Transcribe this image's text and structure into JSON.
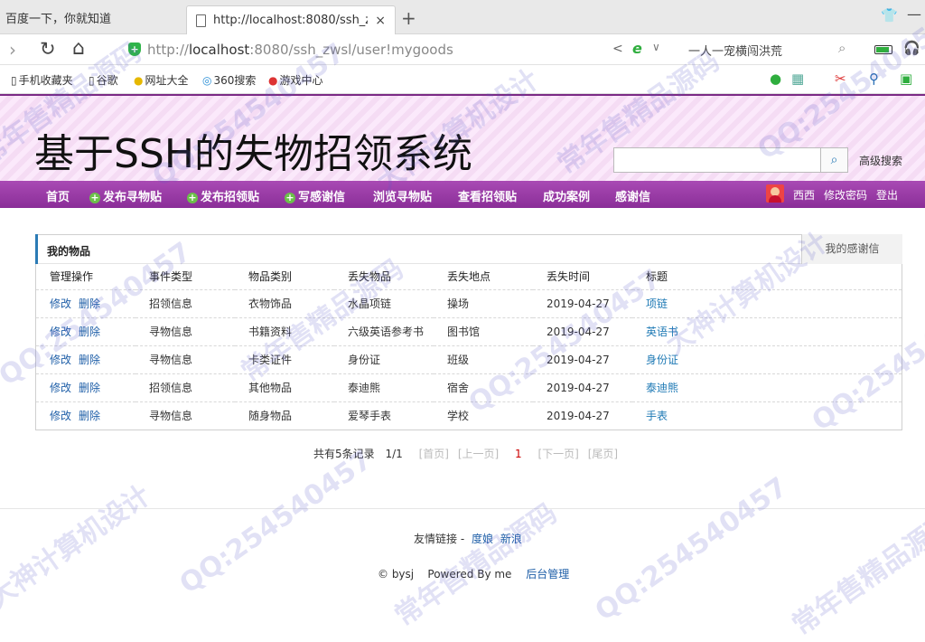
{
  "browser": {
    "tab_inactive": "百度一下，你就知道",
    "tab_active": "http://localhost:8080/ssh_zwsl",
    "tab_close": "×",
    "tab_new": "+",
    "url_prefix": "http://",
    "url_host": "localhost",
    "url_rest": ":8080/ssh_zwsl/user!mygoods",
    "search_suggest": "一人一宠横闯洪荒",
    "bookmarks": [
      "手机收藏夹",
      "谷歌",
      "网址大全",
      "360搜索",
      "游戏中心"
    ]
  },
  "site": {
    "title": "基于SSH的失物招领系统",
    "search_placeholder": "",
    "advanced_search": "高级搜索"
  },
  "nav": {
    "items": [
      "首页",
      "发布寻物贴",
      "发布招领贴",
      "写感谢信",
      "浏览寻物贴",
      "查看招领贴",
      "成功案例",
      "感谢信"
    ],
    "user": "西西",
    "change_password": "修改密码",
    "logout": "登出"
  },
  "panel": {
    "title": "我的物品",
    "tab": "我的感谢信",
    "columns": [
      "管理操作",
      "事件类型",
      "物品类别",
      "丢失物品",
      "丢失地点",
      "丢失时间",
      "标题"
    ],
    "edit_label": "修改",
    "delete_label": "删除",
    "rows": [
      {
        "type": "招领信息",
        "category": "衣物饰品",
        "item": "水晶项链",
        "place": "操场",
        "date": "2019-04-27",
        "title": "项链"
      },
      {
        "type": "寻物信息",
        "category": "书籍资料",
        "item": "六级英语参考书",
        "place": "图书馆",
        "date": "2019-04-27",
        "title": "英语书"
      },
      {
        "type": "寻物信息",
        "category": "卡类证件",
        "item": "身份证",
        "place": "班级",
        "date": "2019-04-27",
        "title": "身份证"
      },
      {
        "type": "招领信息",
        "category": "其他物品",
        "item": "泰迪熊",
        "place": "宿舍",
        "date": "2019-04-27",
        "title": "泰迪熊"
      },
      {
        "type": "寻物信息",
        "category": "随身物品",
        "item": "爱琴手表",
        "place": "学校",
        "date": "2019-04-27",
        "title": "手表"
      }
    ]
  },
  "pager": {
    "summary": "共有5条记录",
    "page_of": "1/1",
    "first": "[首页]",
    "prev": "[上一页]",
    "current": "1",
    "next": "[下一页]",
    "last": "[尾页]"
  },
  "footer": {
    "friend_label": "友情链接 -",
    "links": [
      "度娘",
      "新浪"
    ],
    "copyright": "© bysj",
    "powered": "Powered By me",
    "admin": "后台管理"
  },
  "watermarks": [
    "常年售精品源码",
    "QQ:254540457",
    "大神计算机设计"
  ],
  "colors": {
    "nav_purple": "#8a2e98",
    "link_blue": "#1f5fa8",
    "accent_blue": "#2b7bb5"
  }
}
